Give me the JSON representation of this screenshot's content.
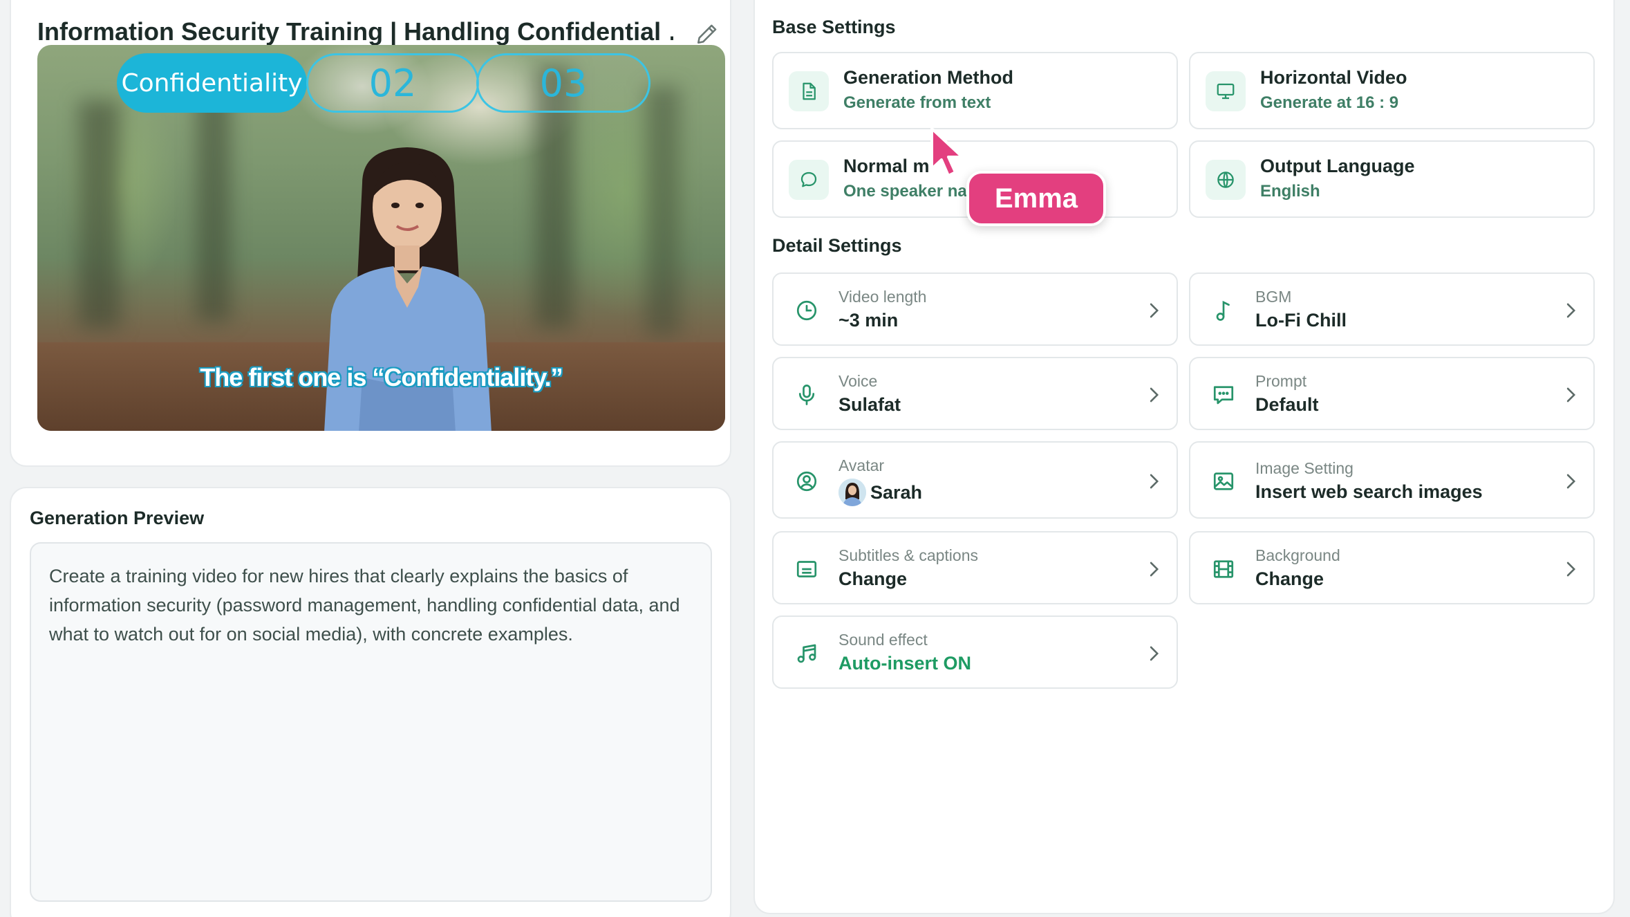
{
  "video": {
    "title": "Information Security Training | Handling Confidential …",
    "pills": [
      "Confidentiality",
      "02",
      "03"
    ],
    "subtitle": "The first one is “Confidentiality.”"
  },
  "preview": {
    "title": "Generation Preview",
    "text": "Create a training video for new hires that clearly explains the basics of information security (password management, handling confidential data, and what to watch out for on social media), with concrete examples."
  },
  "base_settings": {
    "title": "Base Settings",
    "items": [
      {
        "main": "Generation Method",
        "sub": "Generate from text",
        "icon": "document-icon"
      },
      {
        "main": "Horizontal Video",
        "sub": "Generate at 16 : 9",
        "icon": "monitor-icon"
      },
      {
        "main": "Normal m",
        "sub": "One speaker na",
        "icon": "chat-bubble-icon"
      },
      {
        "main": "Output Language",
        "sub": "English",
        "icon": "globe-icon"
      }
    ]
  },
  "detail_settings": {
    "title": "Detail Settings",
    "items": [
      {
        "label": "Video length",
        "value": "~3 min",
        "icon": "clock-icon"
      },
      {
        "label": "BGM",
        "value": "Lo-Fi Chill",
        "icon": "music-note-icon"
      },
      {
        "label": "Voice",
        "value": "Sulafat",
        "icon": "microphone-icon"
      },
      {
        "label": "Prompt",
        "value": "Default",
        "icon": "message-dots-icon"
      },
      {
        "label": "Avatar",
        "value": "Sarah",
        "icon": "user-circle-icon"
      },
      {
        "label": "Image Setting",
        "value": "Insert web search images",
        "icon": "image-icon"
      },
      {
        "label": "Subtitles & captions",
        "value": "Change",
        "icon": "subtitles-icon"
      },
      {
        "label": "Background",
        "value": "Change",
        "icon": "film-icon"
      },
      {
        "label": "Sound effect",
        "value": "Auto-insert ON",
        "icon": "music-notes-icon"
      }
    ]
  },
  "collaborator": {
    "name": "Emma",
    "color": "#e33f7f"
  },
  "colors": {
    "accent": "#1e9b63",
    "pill": "#1cb5d8"
  }
}
